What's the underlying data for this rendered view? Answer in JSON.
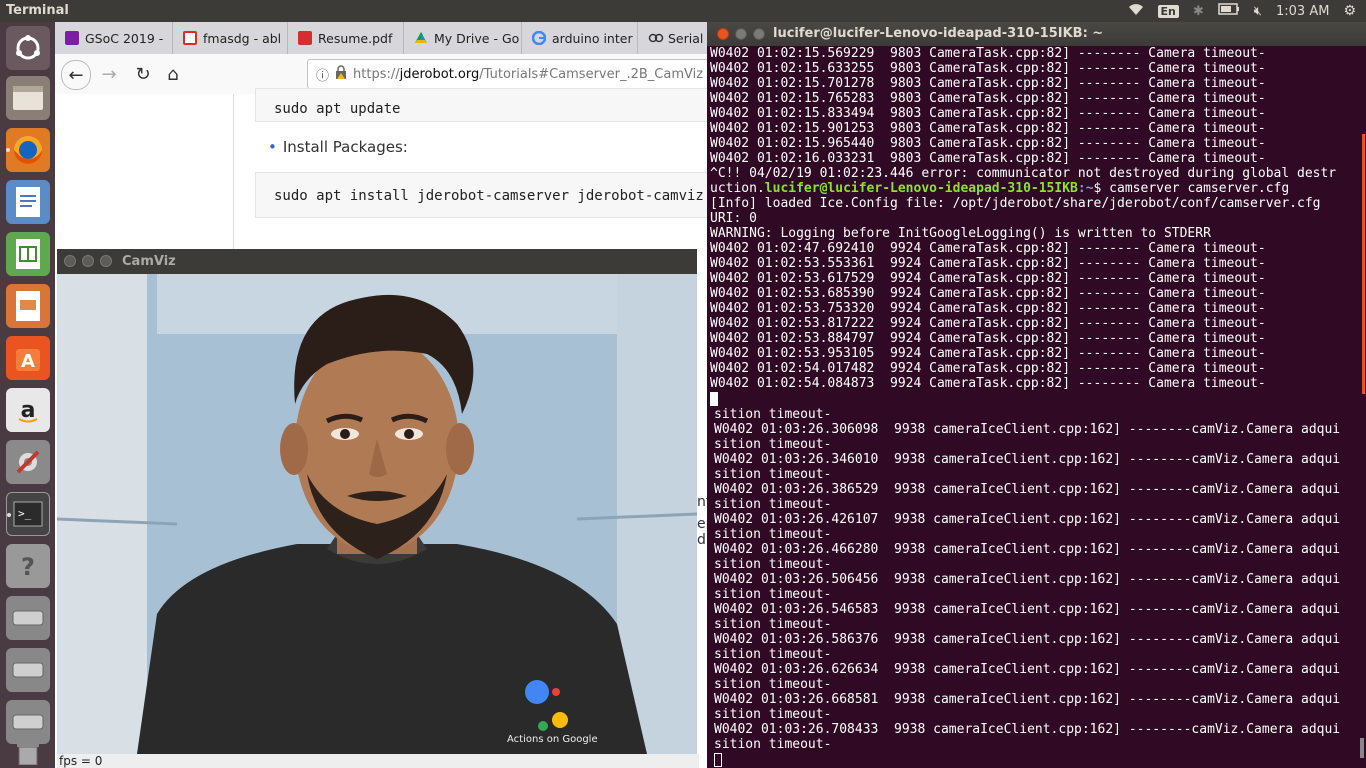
{
  "topbar": {
    "title": "Terminal",
    "keyboard": "En",
    "time": "1:03 AM"
  },
  "launcher": {
    "items": [
      "ubuntu-dash",
      "files",
      "firefox",
      "libreoffice-writer",
      "libreoffice-calc",
      "libreoffice-impress",
      "ubuntu-software",
      "amazon",
      "system-settings",
      "terminal",
      "help",
      "drive-1",
      "drive-2",
      "drive-3",
      "trash"
    ]
  },
  "browser": {
    "tabs": [
      {
        "label": "GSoC 2019 -",
        "icon_color": "#7b1fa2"
      },
      {
        "label": "fmasdg - abl",
        "icon_color": "#d93025"
      },
      {
        "label": "Resume.pdf",
        "icon_color": "#d32f2f"
      },
      {
        "label": "My Drive - Go",
        "icon_color": "#1e88e5"
      },
      {
        "label": "arduino inter",
        "icon_color": "#4285f4"
      },
      {
        "label": "Serial C",
        "icon_color": "#333333"
      }
    ],
    "url_prefix": "https://",
    "url_domain": "jderobot.org",
    "url_path": "/Tutorials#Camserver_.2B_CamViz",
    "content": {
      "code1": "sudo apt update",
      "bullet": "Install Packages:",
      "code2": "sudo apt install jderobot-camserver jderobot-camviz",
      "frag1": "nts",
      "frag2": "er d"
    }
  },
  "camviz": {
    "title": "CamViz",
    "fps": "fps = 0"
  },
  "terminal1": {
    "title": "lucifer@lucifer-Lenovo-ideapad-310-15IKB: ~",
    "lines1": [
      "W0402 01:02:15.569229  9803 CameraTask.cpp:82] -------- Camera timeout-",
      "W0402 01:02:15.633255  9803 CameraTask.cpp:82] -------- Camera timeout-",
      "W0402 01:02:15.701278  9803 CameraTask.cpp:82] -------- Camera timeout-",
      "W0402 01:02:15.765283  9803 CameraTask.cpp:82] -------- Camera timeout-",
      "W0402 01:02:15.833494  9803 CameraTask.cpp:82] -------- Camera timeout-",
      "W0402 01:02:15.901253  9803 CameraTask.cpp:82] -------- Camera timeout-",
      "W0402 01:02:15.965440  9803 CameraTask.cpp:82] -------- Camera timeout-",
      "W0402 01:02:16.033231  9803 CameraTask.cpp:82] -------- Camera timeout-",
      "^C!! 04/02/19 01:02:23.446 error: communicator not destroyed during global destr"
    ],
    "prompt_pre": "uction.",
    "prompt_user": "lucifer@lucifer-Lenovo-ideapad-310-15IKB",
    "prompt_path": ":~",
    "prompt_cmd": "$ camserver camserver.cfg",
    "lines2": [
      "[Info] loaded Ice.Config file: /opt/jderobot/share/jderobot/conf/camserver.cfg",
      "URI: 0",
      "WARNING: Logging before InitGoogleLogging() is written to STDERR",
      "W0402 01:02:47.692410  9924 CameraTask.cpp:82] -------- Camera timeout-",
      "W0402 01:02:53.553361  9924 CameraTask.cpp:82] -------- Camera timeout-",
      "W0402 01:02:53.617529  9924 CameraTask.cpp:82] -------- Camera timeout-",
      "W0402 01:02:53.685390  9924 CameraTask.cpp:82] -------- Camera timeout-",
      "W0402 01:02:53.753320  9924 CameraTask.cpp:82] -------- Camera timeout-",
      "W0402 01:02:53.817222  9924 CameraTask.cpp:82] -------- Camera timeout-",
      "W0402 01:02:53.884797  9924 CameraTask.cpp:82] -------- Camera timeout-",
      "W0402 01:02:53.953105  9924 CameraTask.cpp:82] -------- Camera timeout-",
      "W0402 01:02:54.017482  9924 CameraTask.cpp:82] -------- Camera timeout-",
      "W0402 01:02:54.084873  9924 CameraTask.cpp:82] -------- Camera timeout-"
    ]
  },
  "terminal2": {
    "lines": [
      "sition timeout-",
      "W0402 01:03:26.306098  9938 cameraIceClient.cpp:162] --------camViz.Camera adqui",
      "sition timeout-",
      "W0402 01:03:26.346010  9938 cameraIceClient.cpp:162] --------camViz.Camera adqui",
      "sition timeout-",
      "W0402 01:03:26.386529  9938 cameraIceClient.cpp:162] --------camViz.Camera adqui",
      "sition timeout-",
      "W0402 01:03:26.426107  9938 cameraIceClient.cpp:162] --------camViz.Camera adqui",
      "sition timeout-",
      "W0402 01:03:26.466280  9938 cameraIceClient.cpp:162] --------camViz.Camera adqui",
      "sition timeout-",
      "W0402 01:03:26.506456  9938 cameraIceClient.cpp:162] --------camViz.Camera adqui",
      "sition timeout-",
      "W0402 01:03:26.546583  9938 cameraIceClient.cpp:162] --------camViz.Camera adqui",
      "sition timeout-",
      "W0402 01:03:26.586376  9938 cameraIceClient.cpp:162] --------camViz.Camera adqui",
      "sition timeout-",
      "W0402 01:03:26.626634  9938 cameraIceClient.cpp:162] --------camViz.Camera adqui",
      "sition timeout-",
      "W0402 01:03:26.668581  9938 cameraIceClient.cpp:162] --------camViz.Camera adqui",
      "sition timeout-",
      "W0402 01:03:26.708433  9938 cameraIceClient.cpp:162] --------camViz.Camera adqui",
      "sition timeout-"
    ]
  },
  "video": {
    "shirt_text": "Actions on Google"
  }
}
